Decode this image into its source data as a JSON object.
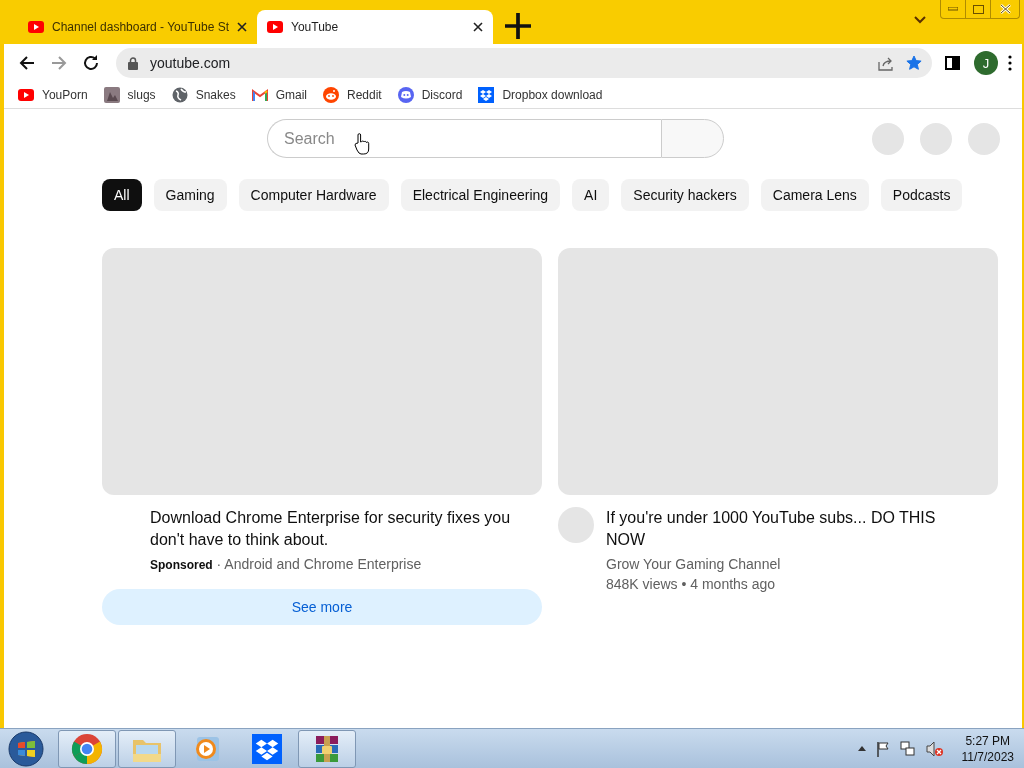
{
  "tabs": [
    {
      "title": "Channel dashboard - YouTube St",
      "selected": false
    },
    {
      "title": "YouTube",
      "selected": true
    }
  ],
  "address_bar": {
    "url": "youtube.com",
    "bookmarked": true
  },
  "profile": {
    "initial": "J"
  },
  "bookmarks": [
    {
      "label": "YouPorn"
    },
    {
      "label": "slugs"
    },
    {
      "label": "Snakes"
    },
    {
      "label": "Gmail"
    },
    {
      "label": "Reddit"
    },
    {
      "label": "Discord"
    },
    {
      "label": "Dropbox download"
    }
  ],
  "search": {
    "placeholder": "Search"
  },
  "chips": [
    {
      "label": "All",
      "selected": true
    },
    {
      "label": "Gaming",
      "selected": false
    },
    {
      "label": "Computer Hardware",
      "selected": false
    },
    {
      "label": "Electrical Engineering",
      "selected": false
    },
    {
      "label": "AI",
      "selected": false
    },
    {
      "label": "Security hackers",
      "selected": false
    },
    {
      "label": "Camera Lens",
      "selected": false
    },
    {
      "label": "Podcasts",
      "selected": false
    }
  ],
  "ad": {
    "title": "Download Chrome Enterprise for security fixes you don't have to think about.",
    "byline": "**Sponsored** · Android and Chrome Enterprise",
    "button": "See more"
  },
  "video": {
    "title": "If you're under 1000 YouTube subs... DO THIS NOW",
    "channel": "Grow Your Gaming Channel",
    "meta": "848K views • 4 months ago"
  },
  "taskbar": {
    "apps": [
      {
        "running": true
      },
      {
        "running": true
      },
      {
        "running": false
      },
      {
        "running": false
      },
      {
        "running": true
      }
    ]
  },
  "clock": {
    "time": "5:27 PM",
    "date": "11/7/2023"
  }
}
